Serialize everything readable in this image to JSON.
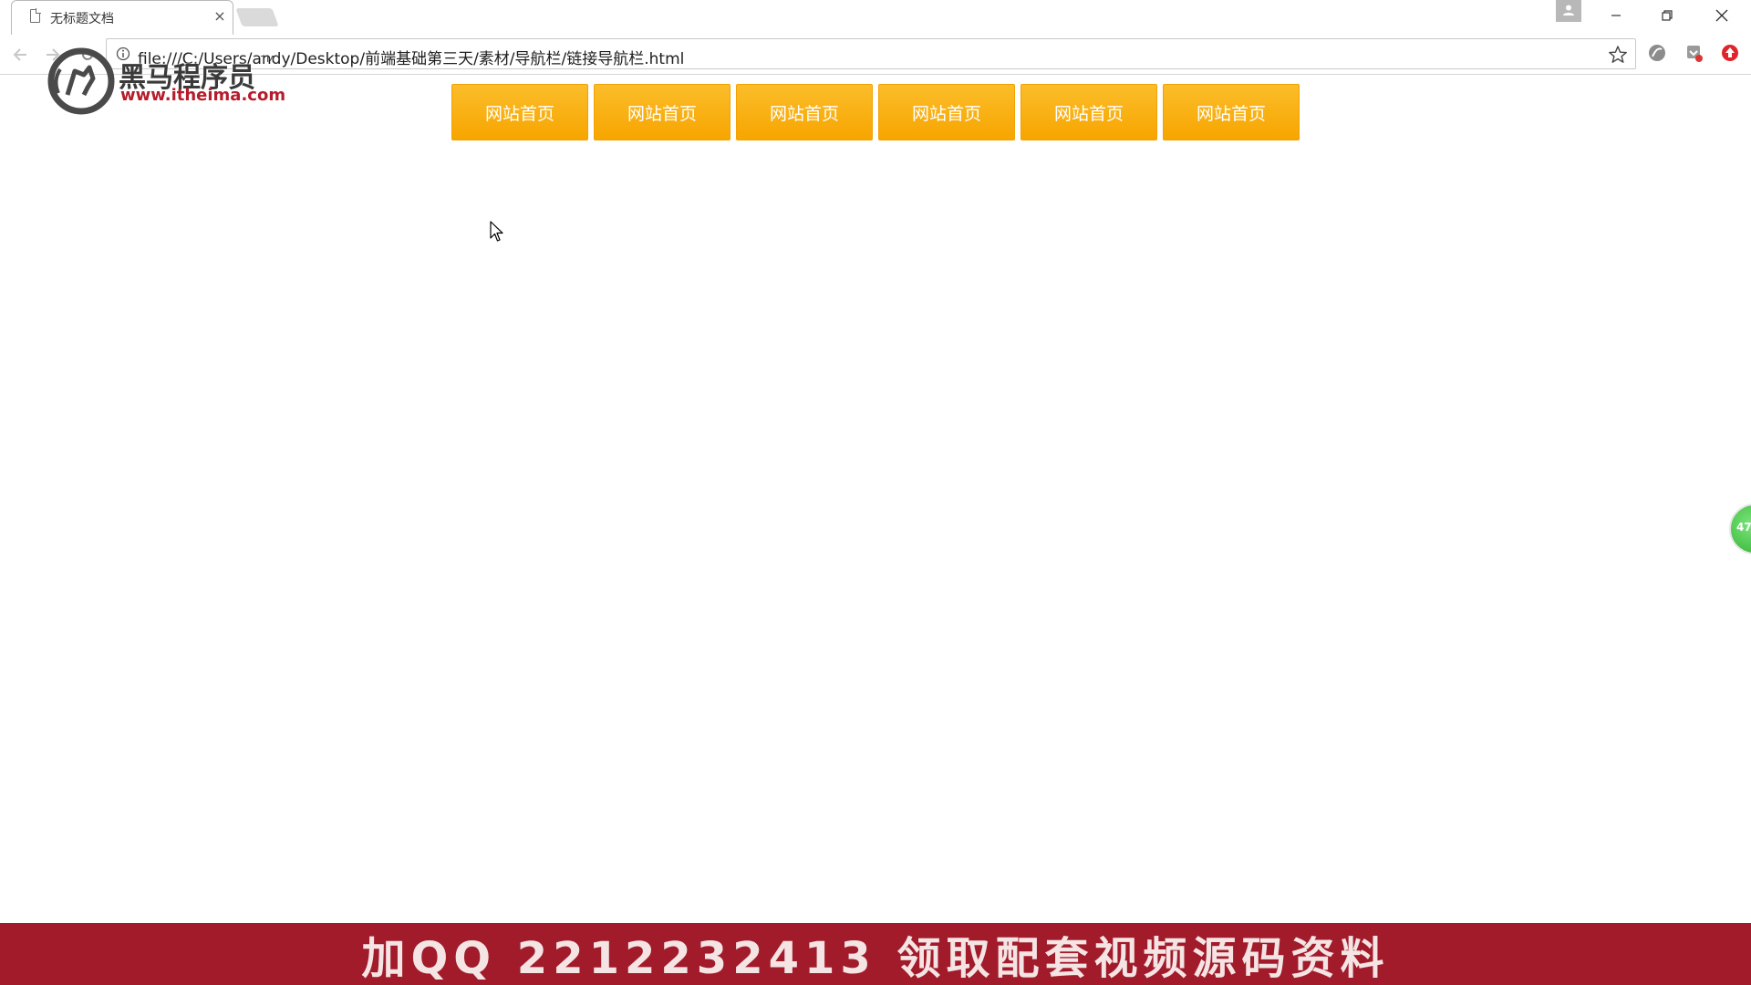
{
  "browser": {
    "tab_title": "无标题文档",
    "tab_close": "×",
    "url": "file:///C:/Users/andy/Desktop/前端基础第三天/素材/导航栏/链接导航栏.html"
  },
  "watermark": {
    "brand_cn": "黑马程序员",
    "trademark": "TM",
    "brand_url": "www.itheima.com"
  },
  "page": {
    "nav_links": [
      {
        "label": "网站首页"
      },
      {
        "label": "网站首页"
      },
      {
        "label": "网站首页"
      },
      {
        "label": "网站首页"
      },
      {
        "label": "网站首页"
      },
      {
        "label": "网站首页"
      }
    ],
    "nav_link_colors": {
      "top": "#fbbd2a",
      "bottom": "#f7a500",
      "text": "#ffffff"
    }
  },
  "float_widget": {
    "value": "47"
  },
  "banner": {
    "text": "加QQ 2212232413  领取配套视频源码资料",
    "background": "#a11b2b"
  }
}
